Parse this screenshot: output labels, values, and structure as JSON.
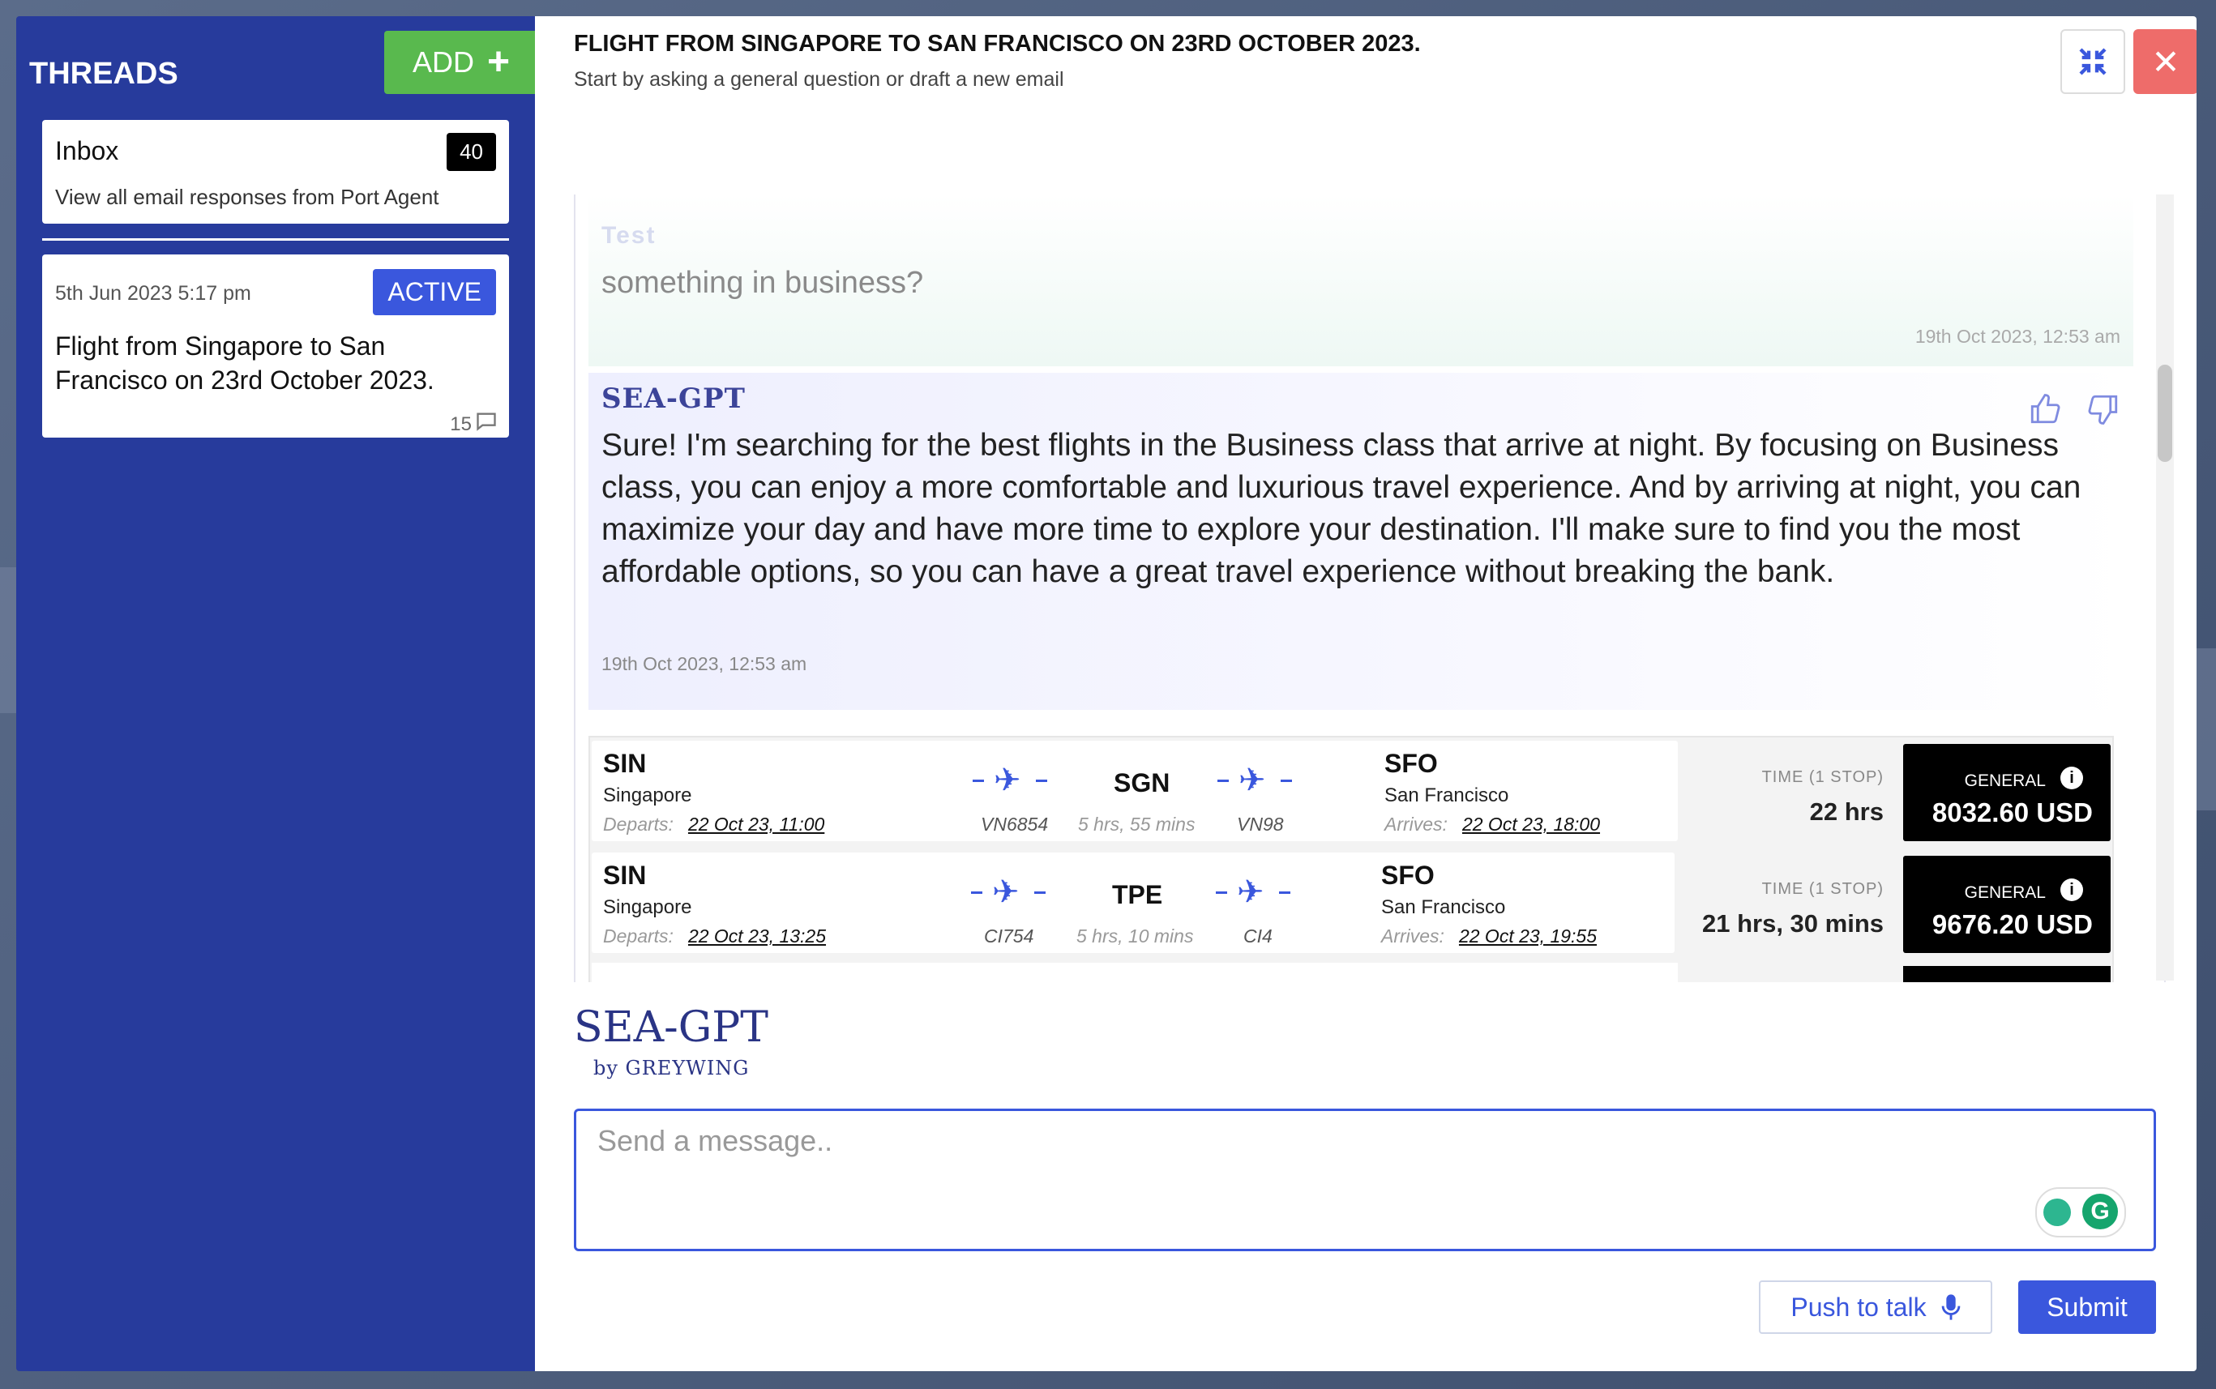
{
  "sidebar": {
    "title": "THREADS",
    "add_label": "ADD",
    "inbox": {
      "title": "Inbox",
      "count": "40",
      "description": "View all email responses from Port Agent"
    },
    "thread": {
      "date": "5th Jun 2023 5:17 pm",
      "badge": "ACTIVE",
      "title": "Flight from Singapore to San Francisco on 23rd October 2023.",
      "comment_count": "15"
    }
  },
  "header": {
    "title": "FLIGHT FROM SINGAPORE TO SAN FRANCISCO ON 23RD OCTOBER 2023.",
    "subtitle": "Start by asking a general question or draft a new email"
  },
  "messages": {
    "user": {
      "name": "Test",
      "text": "something in business?",
      "time": "19th Oct 2023, 12:53 am"
    },
    "bot": {
      "name": "SEA-GPT",
      "text": "Sure! I'm searching for the best flights in the Business class that arrive at night. By focusing on Business class, you can enjoy a more comfortable and luxurious travel experience. And by arriving at night, you can maximize your day and have more time to explore your destination. I'll make sure to find you the most affordable options, so you can have a great travel experience without breaking the bank.",
      "time": "19th Oct 2023, 12:53 am"
    }
  },
  "flights": [
    {
      "origin_code": "SIN",
      "origin_city": "Singapore",
      "departs_label": "Departs:",
      "departs": "22 Oct 23, 11:00",
      "flight1": "VN6854",
      "stop_code": "SGN",
      "stop_duration": "5 hrs, 55 mins",
      "flight2": "VN98",
      "dest_code": "SFO",
      "dest_city": "San Francisco",
      "arrives_label": "Arrives:",
      "arrives": "22 Oct 23, 18:00",
      "time_label": "TIME (1 STOP)",
      "time": "22 hrs",
      "price_label": "GENERAL",
      "price": "8032.60 USD"
    },
    {
      "origin_code": "SIN",
      "origin_city": "Singapore",
      "departs_label": "Departs:",
      "departs": "22 Oct 23, 13:25",
      "flight1": "CI754",
      "stop_code": "TPE",
      "stop_duration": "5 hrs, 10 mins",
      "flight2": "CI4",
      "dest_code": "SFO",
      "dest_city": "San Francisco",
      "arrives_label": "Arrives:",
      "arrives": "22 Oct 23, 19:55",
      "time_label": "TIME (1 STOP)",
      "time": "21 hrs, 30 mins",
      "price_label": "GENERAL",
      "price": "9676.20 USD"
    }
  ],
  "branding": {
    "logo": "SEA-GPT",
    "by": "by GREYWING"
  },
  "composer": {
    "placeholder": "Send a message..",
    "grammar_letter": "G",
    "push_to_talk": "Push to talk",
    "submit": "Submit"
  },
  "colors": {
    "sidebar_bg": "#273b9c",
    "accent": "#3a57dd",
    "add_green": "#59b94e",
    "close_red": "#ee6c6a"
  },
  "icons": {
    "add": "plus-icon",
    "compress": "compress-icon",
    "close": "close-icon",
    "thumb_up": "thumbs-up-icon",
    "thumb_down": "thumbs-down-icon",
    "plane": "plane-icon",
    "info": "info-icon",
    "microphone": "microphone-icon",
    "comment": "comment-icon"
  }
}
